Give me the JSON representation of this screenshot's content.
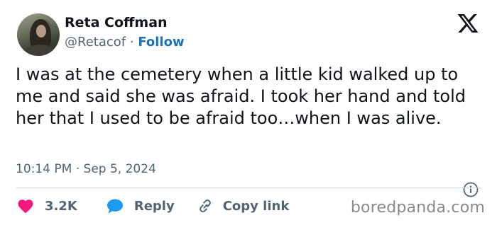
{
  "author": {
    "display_name": "Reta Coffman",
    "handle": "@Retacof",
    "separator": "·",
    "follow_label": "Follow",
    "avatar_icon": "profile-photo"
  },
  "platform_icon": "x-logo-icon",
  "tweet": {
    "text": "I was at the cemetery when a little kid walked up to me and said she was afraid. I took her hand and told her that I used to be afraid too…when I was alive.",
    "time": "10:14 PM",
    "date_separator": "·",
    "date": "Sep 5, 2024"
  },
  "actions": {
    "likes_count": "3.2K",
    "reply_label": "Reply",
    "copy_link_label": "Copy link"
  },
  "watermark": "boredpanda.com",
  "colors": {
    "text": "#0f1419",
    "secondary_text": "#536471",
    "follow_link": "#1d72b8",
    "like_heart": "#f91880",
    "reply_bubble": "#1d9bf0",
    "divider": "#cfd9de"
  }
}
